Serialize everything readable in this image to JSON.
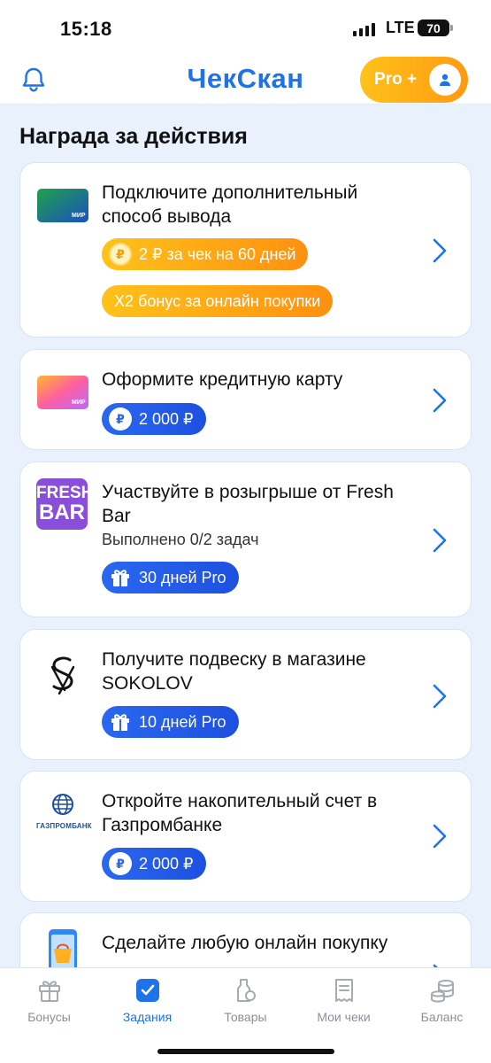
{
  "status_bar": {
    "time": "15:18",
    "network": "LTE",
    "battery": "70"
  },
  "header": {
    "app_name": "ЧекСкан",
    "pro_label": "Pro +",
    "icons": {
      "left": "bell-icon",
      "avatar": "user-icon"
    }
  },
  "section_title": "Награда за действия",
  "cards": [
    {
      "title": "Подключите дополнительный способ вывода",
      "icon": "mir-card-green-icon",
      "badges": [
        {
          "style": "orange",
          "icon": "coin-icon",
          "text": "2 ₽ за чек на 60 дней"
        },
        {
          "style": "orange",
          "icon": "",
          "text": "Х2 бонус за онлайн покупки"
        }
      ]
    },
    {
      "title": "Оформите кредитную карту",
      "icon": "mir-card-gradient-icon",
      "badges": [
        {
          "style": "blue",
          "icon": "coin-icon",
          "text": "2 000 ₽"
        }
      ]
    },
    {
      "title": "Участвуйте в розыгрыше от Fresh Bar",
      "subtitle": "Выполнено 0/2 задач",
      "icon": "fresh-bar-logo",
      "logo_text": [
        "FRESH",
        "BAR"
      ],
      "badges": [
        {
          "style": "blue",
          "icon": "gift-icon",
          "text": "30 дней Pro"
        }
      ]
    },
    {
      "title": "Получите подвеску в магазине SOKOLOV",
      "icon": "sokolov-logo",
      "badges": [
        {
          "style": "blue",
          "icon": "gift-icon",
          "text": "10 дней Pro"
        }
      ]
    },
    {
      "title": "Откройте накопительный счет в Газпромбанке",
      "icon": "gazprombank-logo",
      "logo_text": "ГАЗПРОМБАНК",
      "badges": [
        {
          "style": "blue",
          "icon": "coin-icon",
          "text": "2 000 ₽"
        }
      ]
    },
    {
      "title": "Сделайте любую онлайн покупку",
      "icon": "shopping-phone-icon",
      "badges": []
    }
  ],
  "coin_symbol": "₽",
  "tabbar": [
    {
      "label": "Бонусы",
      "icon": "gift-icon",
      "active": false
    },
    {
      "label": "Задания",
      "icon": "checkbox-icon",
      "active": true
    },
    {
      "label": "Товары",
      "icon": "grocery-bag-icon",
      "active": false
    },
    {
      "label": "Мои чеки",
      "icon": "receipt-icon",
      "active": false
    },
    {
      "label": "Баланс",
      "icon": "coins-stack-icon",
      "active": false
    }
  ],
  "colors": {
    "accent": "#1E73E8",
    "orange": "#FF9A12",
    "background": "#E9F1FC"
  }
}
